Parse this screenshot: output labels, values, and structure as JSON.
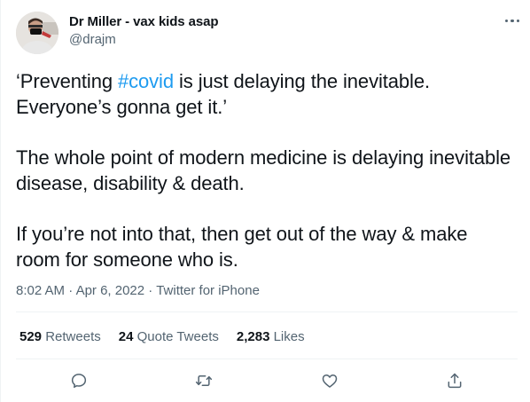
{
  "author": {
    "display_name": "Dr Miller - vax kids asap",
    "handle": "@drajm"
  },
  "tweet": {
    "line1_before": "‘Preventing ",
    "hashtag": "#covid",
    "line1_after": " is just delaying the inevitable. Everyone’s gonna get it.’",
    "paragraph2": "The whole point of modern medicine is delaying inevitable disease, disability & death.",
    "paragraph3": "If you’re not into that, then get out of the way & make room for someone who is."
  },
  "meta": {
    "time": "8:02 AM",
    "separator1": " · ",
    "date": "Apr 6, 2022",
    "separator2": " · ",
    "source": "Twitter for iPhone"
  },
  "stats": {
    "retweets_count": "529",
    "retweets_label": "Retweets",
    "quotes_count": "24",
    "quotes_label": "Quote Tweets",
    "likes_count": "2,283",
    "likes_label": "Likes"
  },
  "icons": {
    "more": "more-horizontal-icon",
    "reply": "reply-icon",
    "retweet": "retweet-icon",
    "like": "heart-icon",
    "share": "share-icon"
  },
  "colors": {
    "text": "#0f1419",
    "secondary": "#536471",
    "link": "#1d9bf0",
    "divider": "#eff3f4"
  }
}
